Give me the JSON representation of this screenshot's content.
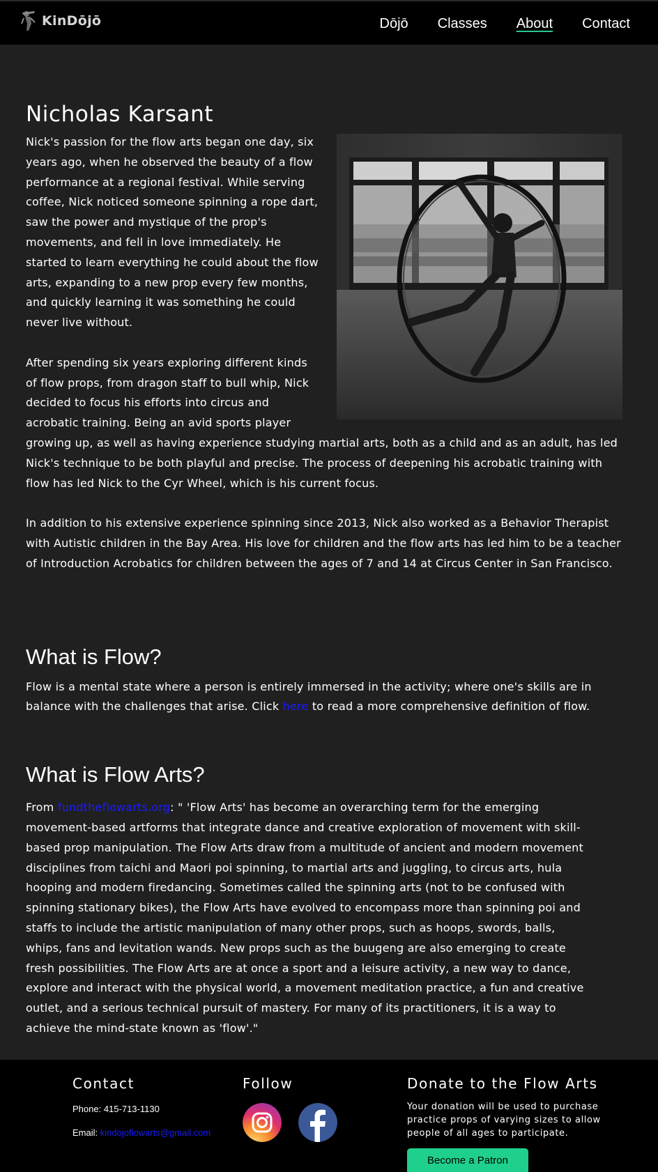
{
  "nav": {
    "brand": "KinDōjō",
    "links": [
      "Dōjō",
      "Classes",
      "About",
      "Contact"
    ],
    "active": "About"
  },
  "bio": {
    "name": "Nicholas Karsant",
    "photo_alt": "person-in-cyr-wheel-photo",
    "paragraphs": [
      "Nick's passion for the flow arts began one day, six years ago, when he observed the beauty of a flow performance at a regional festival. While serving coffee, Nick noticed someone spinning a rope dart, saw the power and mystique of the prop's movements, and fell in love immediately. He started to learn everything he could about the flow arts, expanding to a new prop every few months, and quickly learning it was something he could never live without.",
      "After spending six years exploring different kinds of flow props, from dragon staff to bull whip, Nick decided to focus his efforts into circus and acrobatic training. Being an avid sports player growing up, as well as having experience studying martial arts, both as a child and as an adult, has led Nick's technique to be both playful and precise. The process of deepening his acrobatic training with flow has led Nick to the Cyr Wheel, which is his current focus.",
      "In addition to his extensive experience spinning since 2013, Nick also worked as a Behavior Therapist with Autistic children in the Bay Area. His love for children and the flow arts has led him to be a teacher of Introduction Acrobatics for children between the ages of 7 and 14 at Circus Center in San Francisco."
    ]
  },
  "flow": {
    "heading": "What is Flow?",
    "text_before": "Flow is a mental state where a person is entirely immersed in the activity; where one's skills are in balance with the challenges that arise. Click ",
    "link": "here",
    "text_after": " to read a more comprehensive definition of flow."
  },
  "flow_arts": {
    "heading": "What is Flow Arts?",
    "text_before": "From ",
    "link": "fundtheflowarts.org",
    "text_after": ": \" 'Flow Arts' has become an overarching term for the emerging movement-based artforms that integrate dance and creative exploration of movement with skill-based prop manipulation. The Flow Arts draw from a multitude of ancient and modern movement disciplines from taichi and Maori poi spinning, to martial arts and juggling, to circus arts, hula hooping and modern firedancing. Sometimes called the spinning arts (not to be confused with spinning stationary bikes), the Flow Arts have evolved to encompass more than spinning poi and staffs to include the artistic manipulation of many other props, such as hoops, swords, balls, whips, fans and levitation wands. New props such as the buugeng are also emerging to create fresh possibilities. The Flow Arts are at once a sport and a leisure activity, a new way to dance, explore and interact with the physical world, a movement meditation practice, a fun and creative outlet, and a serious technical pursuit of mastery. For many of its practitioners, it is a way to achieve the mind-state known as 'flow'.\""
  },
  "footer": {
    "contact": {
      "heading": "Contact",
      "phone": "Phone: 415-713-1130",
      "email_label": "Email: ",
      "email": "kindojoflowarts@gmail.com"
    },
    "follow": {
      "heading": "Follow",
      "icons": [
        "instagram-icon",
        "facebook-icon"
      ]
    },
    "donate": {
      "heading": "Donate to the Flow Arts",
      "text": "Your donation will be used to purchase practice props of varying sizes to allow people of all ages to participate.",
      "button": "Become a Patron"
    }
  },
  "colors": {
    "background": "#202020",
    "nav": "#000000",
    "accent": "#1fd08d",
    "link": "#1a1aff"
  }
}
